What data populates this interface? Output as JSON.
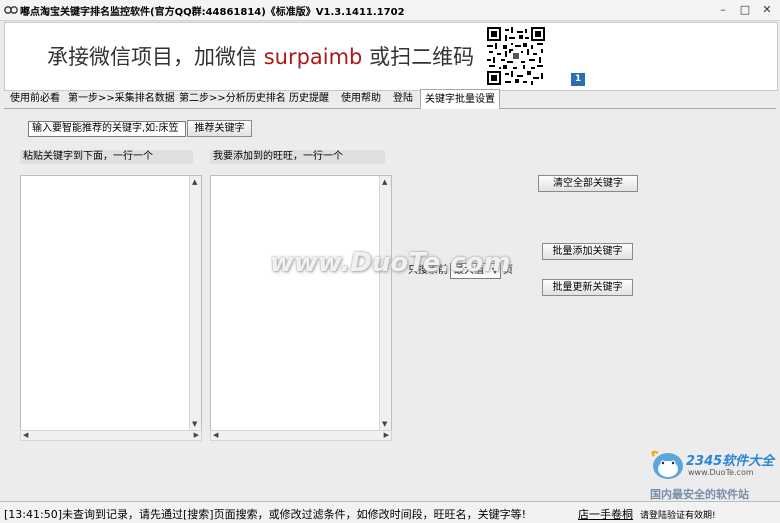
{
  "window": {
    "title": "嘟点淘宝关键字排名监控软件(官方QQ群:44861814)《标准版》V1.3.1411.1702"
  },
  "banner": {
    "text_before": "承接微信项目，加微信",
    "text_highlight": "surpaimb",
    "text_after": "或扫二维码",
    "badge": "1",
    "highlight_color": "#b01818"
  },
  "tabs": [
    {
      "label": "使用前必看"
    },
    {
      "label": "第一步>>采集排名数据"
    },
    {
      "label": "第二步>>分析历史排名"
    },
    {
      "label": "历史提醒"
    },
    {
      "label": "使用帮助"
    },
    {
      "label": "登陆"
    },
    {
      "label": "关键字批量设置",
      "active": true
    }
  ],
  "keyword_panel": {
    "search_input_value": "输入要智能推荐的关键字,如:床笠",
    "recommend_button": "推荐关键字",
    "left_label": "粘贴关键字到下面，一行一个",
    "right_label": "我要添加到的旺旺，一行一个",
    "clear_button": "清空全部关键字",
    "search_prefix": "只搜索前",
    "page_select_value": "最大值",
    "page_suffix": "页",
    "batch_add_button": "批量添加关键字",
    "batch_update_button": "批量更新关键字"
  },
  "status_bar": {
    "message": "[13:41:50]未查询到记录，请先通过[搜索]页面搜索，或修改过滤条件，如修改时间段，旺旺名，关键字等!",
    "link": "店一手卷桐",
    "note": "请登陆验证有效期!"
  },
  "watermarks": {
    "duote": "www.DuoTe.com",
    "brand": "2345软件大全",
    "brand_url": "www.DuoTe.com",
    "brand_slogan": "国内最安全的软件站"
  }
}
